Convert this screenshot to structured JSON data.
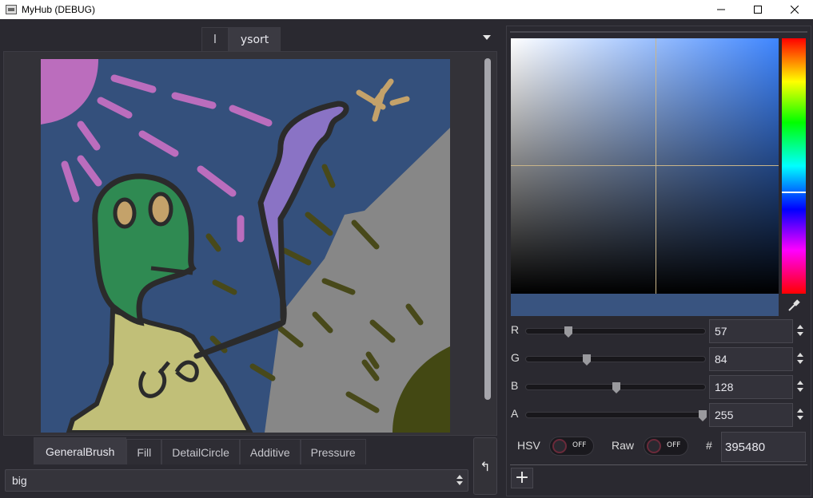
{
  "window": {
    "title": "MyHub (DEBUG)",
    "minimize_icon": "minimize-icon",
    "maximize_icon": "maximize-icon",
    "close_icon": "close-icon"
  },
  "document_tabs": [
    {
      "label": "l",
      "active": false
    },
    {
      "label": "ysort",
      "active": true
    }
  ],
  "tool_tabs": [
    {
      "label": "GeneralBrush",
      "active": true
    },
    {
      "label": "Fill",
      "active": false
    },
    {
      "label": "DetailCircle",
      "active": false
    },
    {
      "label": "Additive",
      "active": false
    },
    {
      "label": "Pressure",
      "active": false
    }
  ],
  "brush_select": {
    "value": "big"
  },
  "undo": {
    "icon": "undo-arrow-icon",
    "glyph": "↰"
  },
  "color": {
    "hex": "395480",
    "preview": "#395480",
    "channels": [
      {
        "label": "R",
        "value": "57",
        "fraction": 0.2235
      },
      {
        "label": "G",
        "value": "84",
        "fraction": 0.3294
      },
      {
        "label": "B",
        "value": "128",
        "fraction": 0.502
      },
      {
        "label": "A",
        "value": "255",
        "fraction": 1.0
      }
    ],
    "hsv_label": "HSV",
    "raw_label": "Raw",
    "toggle_state_text": "OFF",
    "hash": "#",
    "add_label": "+",
    "picker_icon": "eyedropper-icon"
  },
  "colors": {
    "canvas_bg": "#34507c",
    "gray_mountain": "#878787",
    "purple_arm": "#8a73c5",
    "green_head": "#2f8a52",
    "yellow_body": "#c1bf78",
    "pink_marks": "#bb6dbd",
    "olive_marks": "#48491a",
    "olive_bush": "#434813",
    "tan_star": "#c4a26a",
    "outline": "#2b2b2b"
  }
}
